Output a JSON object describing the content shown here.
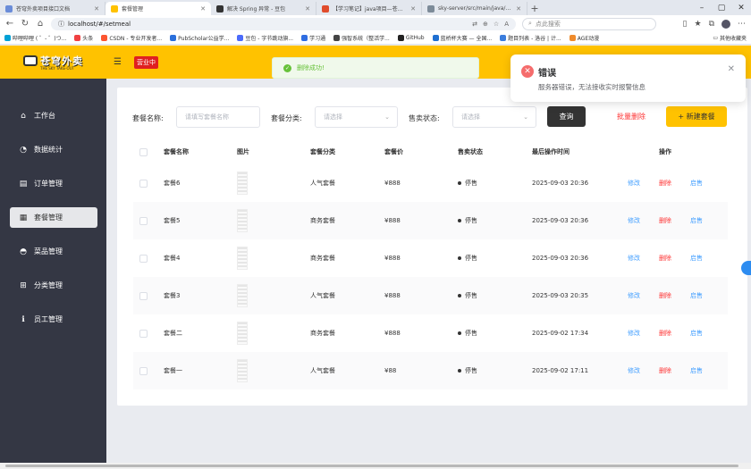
{
  "browser": {
    "tabs": [
      {
        "label": "苍穹外卖项目接口文档",
        "color": "#6a8cd8",
        "active": false
      },
      {
        "label": "套餐管理",
        "color": "#ffc200",
        "active": true
      },
      {
        "label": "解决 Spring 异常 - 豆包",
        "color": "#333333",
        "active": false
      },
      {
        "label": "【学习笔记】java项目—苍穹外卖",
        "color": "#e04c2c",
        "active": false
      },
      {
        "label": "sky-server/src/main/java/com/sky",
        "color": "#7d8b99",
        "active": false
      }
    ],
    "url": "localhost/#/setmeal",
    "search_placeholder": "点此搜索",
    "bookmarks": [
      {
        "label": "哔哩哔哩 ( ゜- ゜)つ...",
        "color": "#00a1d6"
      },
      {
        "label": "头条",
        "color": "#f04142"
      },
      {
        "label": "CSDN - 专业开发者...",
        "color": "#fc5531"
      },
      {
        "label": "PubScholar公益学...",
        "color": "#2a6fdb"
      },
      {
        "label": "豆包 - 字节跳动旗...",
        "color": "#4b6bfb"
      },
      {
        "label": "学习通",
        "color": "#2f6de1"
      },
      {
        "label": "强智系统（整活学...",
        "color": "#444444"
      },
      {
        "label": "GitHub",
        "color": "#222222"
      },
      {
        "label": "蓝桥杯大赛 — 全国...",
        "color": "#1f6fd1"
      },
      {
        "label": "题目列表 - 洛谷 | 计...",
        "color": "#3b7ddd"
      },
      {
        "label": "AGE动漫",
        "color": "#ef8b2c"
      }
    ],
    "other_bookmarks": "其他收藏夹"
  },
  "header": {
    "logo_text": "苍穹外卖",
    "logo_sub": "THE SKY TAKE-OUT",
    "status": "营业中"
  },
  "sidebar": {
    "items": [
      {
        "label": "工作台",
        "icon": "home-icon",
        "glyph": "⌂",
        "active": false
      },
      {
        "label": "数据统计",
        "icon": "chart-icon",
        "glyph": "◔",
        "active": false
      },
      {
        "label": "订单管理",
        "icon": "order-icon",
        "glyph": "▤",
        "active": false
      },
      {
        "label": "套餐管理",
        "icon": "setmeal-icon",
        "glyph": "▦",
        "active": true
      },
      {
        "label": "菜品管理",
        "icon": "dish-icon",
        "glyph": "◓",
        "active": false
      },
      {
        "label": "分类管理",
        "icon": "category-icon",
        "glyph": "⊞",
        "active": false
      },
      {
        "label": "员工管理",
        "icon": "employee-icon",
        "glyph": "ℹ",
        "active": false
      }
    ]
  },
  "filters": {
    "name_label": "套餐名称:",
    "name_placeholder": "请填写套餐名称",
    "category_label": "套餐分类:",
    "category_placeholder": "请选择",
    "status_label": "售卖状态:",
    "status_placeholder": "请选择",
    "query_button": "查询",
    "batch_delete": "批量删除",
    "new_button": "+ 新建套餐"
  },
  "table": {
    "columns": [
      "套餐名称",
      "图片",
      "套餐分类",
      "套餐价",
      "售卖状态",
      "最后操作时间",
      "操作"
    ],
    "rows": [
      {
        "name": "套餐6",
        "category": "人气套餐",
        "price": "¥888",
        "status": "停售",
        "time": "2025-09-03 20:36"
      },
      {
        "name": "套餐5",
        "category": "商务套餐",
        "price": "¥888",
        "status": "停售",
        "time": "2025-09-03 20:36"
      },
      {
        "name": "套餐4",
        "category": "商务套餐",
        "price": "¥888",
        "status": "停售",
        "time": "2025-09-03 20:36"
      },
      {
        "name": "套餐3",
        "category": "人气套餐",
        "price": "¥888",
        "status": "停售",
        "time": "2025-09-03 20:35"
      },
      {
        "name": "套餐二",
        "category": "商务套餐",
        "price": "¥888",
        "status": "停售",
        "time": "2025-09-02 17:34"
      },
      {
        "name": "套餐一",
        "category": "人气套餐",
        "price": "¥88",
        "status": "停售",
        "time": "2025-09-02 17:11"
      }
    ],
    "actions": {
      "edit": "修改",
      "delete": "删除",
      "enable": "启售"
    }
  },
  "toast": {
    "message": "删除成功!"
  },
  "notification": {
    "title": "错误",
    "message": "服务器错误，无法接收实时报警信息"
  }
}
